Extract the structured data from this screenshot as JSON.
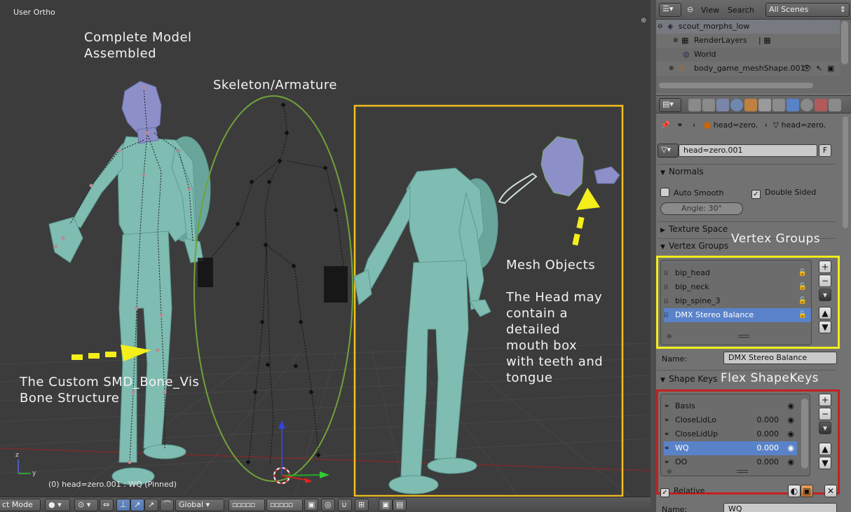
{
  "viewport": {
    "title": "User Ortho",
    "status": "(0) head=zero.001 : WQ (Pinned)",
    "annotations": {
      "complete_model_1": "Complete Model",
      "complete_model_2": "Assembled",
      "skeleton": "Skeleton/Armature",
      "mesh_objects": "Mesh Objects",
      "head_1": "The Head may",
      "head_2": "contain a",
      "head_3": "detailed",
      "head_4": "mouth box",
      "head_5": "with teeth and",
      "head_6": "tongue",
      "custom_bone_1": "The Custom SMD_Bone_Vis",
      "custom_bone_2": "Bone Structure"
    },
    "colors": {
      "skeleton_ellipse": "#6fa33a",
      "mesh_box": "#f3c020",
      "arrow": "#f4ee1a",
      "mesh": "#7fbcb2"
    }
  },
  "toolbar": {
    "mode": "ct Mode",
    "orientation": "Global"
  },
  "outliner": {
    "view": "View",
    "search": "Search",
    "scenes": "All Scenes",
    "rows": [
      {
        "label": "scout_morphs_low"
      },
      {
        "label": "RenderLayers"
      },
      {
        "label": "World"
      },
      {
        "label": "body_game_meshShape.001"
      }
    ]
  },
  "properties": {
    "breadcrumb_obj": "head=zero.",
    "breadcrumb_data": "head=zero.",
    "mesh_name": "head=zero.001",
    "fake_user": "F",
    "normals": {
      "title": "Normals",
      "auto_smooth": "Auto Smooth",
      "double_sided": "Double Sided",
      "angle": "Angle: 30°"
    },
    "texture_space": "Texture Space",
    "vertex_groups": {
      "title": "Vertex Groups",
      "overlay": "Vertex Groups",
      "items": [
        {
          "label": "bip_head"
        },
        {
          "label": "bip_neck"
        },
        {
          "label": "bip_spine_3"
        },
        {
          "label": "DMX Stereo Balance"
        }
      ],
      "name_label": "Name:",
      "name_value": "DMX Stereo Balance"
    },
    "shape_keys": {
      "title": "Shape Keys",
      "overlay": "Flex ShapeKeys",
      "items": [
        {
          "label": "Basis",
          "value": ""
        },
        {
          "label": "CloseLidLo",
          "value": "0.000"
        },
        {
          "label": "CloseLidUp",
          "value": "0.000"
        },
        {
          "label": "WQ",
          "value": "0.000"
        },
        {
          "label": "OO",
          "value": "0.000"
        }
      ],
      "relative": "Relative",
      "name_label": "Name:",
      "name_value": "WQ"
    }
  }
}
